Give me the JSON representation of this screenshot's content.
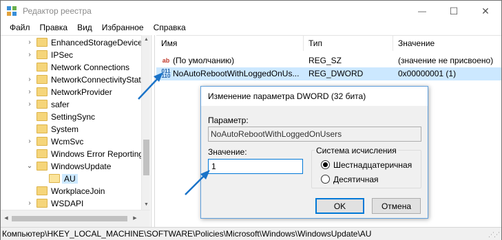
{
  "window": {
    "title": "Редактор реестра",
    "controls": {
      "minimize": "—",
      "maximize": "☐",
      "close": "✕"
    }
  },
  "menu": [
    "Файл",
    "Правка",
    "Вид",
    "Избранное",
    "Справка"
  ],
  "tree": {
    "items": [
      {
        "label": "EnhancedStorageDevices",
        "chevron": "›"
      },
      {
        "label": "IPSec",
        "chevron": "›"
      },
      {
        "label": "Network Connections",
        "chevron": ""
      },
      {
        "label": "NetworkConnectivityStat",
        "chevron": "›"
      },
      {
        "label": "NetworkProvider",
        "chevron": "›"
      },
      {
        "label": "safer",
        "chevron": "›"
      },
      {
        "label": "SettingSync",
        "chevron": ""
      },
      {
        "label": "System",
        "chevron": ""
      },
      {
        "label": "WcmSvc",
        "chevron": "›"
      },
      {
        "label": "Windows Error Reporting",
        "chevron": ""
      },
      {
        "label": "WindowsUpdate",
        "chevron": "⌄"
      },
      {
        "label": "AU",
        "chevron": "",
        "selected": true
      },
      {
        "label": "WorkplaceJoin",
        "chevron": ""
      },
      {
        "label": "WSDAPI",
        "chevron": "›"
      }
    ]
  },
  "list": {
    "columns": [
      "Имя",
      "Тип",
      "Значение"
    ],
    "rows": [
      {
        "icon": "string-value-icon",
        "icon_text": "ab",
        "name": "(По умолчанию)",
        "type": "REG_SZ",
        "value": "(значение не присвоено)",
        "selected": false
      },
      {
        "icon": "binary-value-icon",
        "icon_text": "011\n110",
        "name": "NoAutoRebootWithLoggedOnUs...",
        "type": "REG_DWORD",
        "value": "0x00000001 (1)",
        "selected": true
      }
    ]
  },
  "status_path": "Компьютер\\HKEY_LOCAL_MACHINE\\SOFTWARE\\Policies\\Microsoft\\Windows\\WindowsUpdate\\AU",
  "dialog": {
    "title": "Изменение параметра DWORD (32 бита)",
    "param_label": "Параметр:",
    "param_value": "NoAutoRebootWithLoggedOnUsers",
    "value_label": "Значение:",
    "value_input": "1",
    "base_label": "Система исчисления",
    "base_options": [
      {
        "label": "Шестнадцатеричная",
        "checked": true
      },
      {
        "label": "Десятичная",
        "checked": false
      }
    ],
    "ok": "OK",
    "cancel": "Отмена"
  },
  "colors": {
    "selection": "#cce8ff",
    "annotation_arrow": "#1a73c8",
    "focus_border": "#0078d7"
  }
}
